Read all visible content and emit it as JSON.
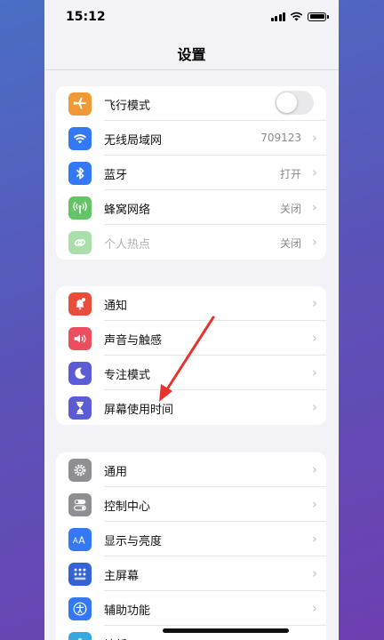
{
  "status_bar": {
    "time": "15:12"
  },
  "nav": {
    "title": "设置"
  },
  "groups": [
    {
      "rows": [
        {
          "label": "飞行模式",
          "icon": "airplane-icon",
          "color": "#f09a37",
          "control": "toggle",
          "toggle_on": false
        },
        {
          "label": "无线局域网",
          "icon": "wifi-icon",
          "color": "#3478f6",
          "value": "709123"
        },
        {
          "label": "蓝牙",
          "icon": "bluetooth-icon",
          "color": "#3478f6",
          "value": "打开"
        },
        {
          "label": "蜂窝网络",
          "icon": "cellular-antenna-icon",
          "color": "#65c466",
          "value": "关闭"
        },
        {
          "label": "个人热点",
          "icon": "hotspot-link-icon",
          "color": "#65c466",
          "value": "关闭",
          "dimmed": true
        }
      ]
    },
    {
      "rows": [
        {
          "label": "通知",
          "icon": "notification-bell-icon",
          "color": "#eb4d3d"
        },
        {
          "label": "声音与触感",
          "icon": "speaker-icon",
          "color": "#eb4e5e"
        },
        {
          "label": "专注模式",
          "icon": "moon-icon",
          "color": "#5b5bd6"
        },
        {
          "label": "屏幕使用时间",
          "icon": "hourglass-icon",
          "color": "#5b5bd6"
        }
      ]
    },
    {
      "rows": [
        {
          "label": "通用",
          "icon": "gear-icon",
          "color": "#8e8e93"
        },
        {
          "label": "控制中心",
          "icon": "control-toggles-icon",
          "color": "#8e8e93"
        },
        {
          "label": "显示与亮度",
          "icon": "text-size-icon",
          "color": "#3478f6"
        },
        {
          "label": "主屏幕",
          "icon": "home-grid-icon",
          "color": "#3563d4"
        },
        {
          "label": "辅助功能",
          "icon": "accessibility-icon",
          "color": "#3478f6"
        },
        {
          "label": "墙纸",
          "icon": "wallpaper-icon",
          "color": "#36a8e0"
        }
      ]
    }
  ],
  "annotation": {
    "type": "red-arrow",
    "color": "#e8322c",
    "points_to": "屏幕使用时间"
  }
}
